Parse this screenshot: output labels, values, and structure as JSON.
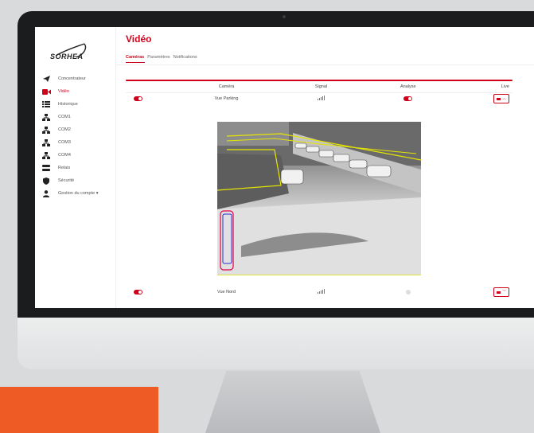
{
  "brand": {
    "logo_text": "SORHEA"
  },
  "page": {
    "title": "Vidéo"
  },
  "tabs": [
    {
      "label": "Caméras",
      "active": true
    },
    {
      "label": "Paramètres",
      "active": false
    },
    {
      "label": "Notifications",
      "active": false
    }
  ],
  "sidebar": {
    "items": [
      {
        "label": "Concentrateur",
        "icon": "send-icon"
      },
      {
        "label": "Vidéo",
        "icon": "video-camera-icon",
        "active": true
      },
      {
        "label": "Historique",
        "icon": "list-icon"
      },
      {
        "label": "COM1",
        "icon": "network-icon"
      },
      {
        "label": "COM2",
        "icon": "network-icon"
      },
      {
        "label": "COM3",
        "icon": "network-icon"
      },
      {
        "label": "COM4",
        "icon": "network-icon"
      },
      {
        "label": "Relais",
        "icon": "relay-icon"
      },
      {
        "label": "Sécurité",
        "icon": "shield-icon"
      },
      {
        "label": "Gestion du compte ▾",
        "icon": "user-icon"
      }
    ]
  },
  "table": {
    "headers": [
      "Caméra",
      "Signal",
      "Analyse",
      "Live"
    ],
    "rows": [
      {
        "enabled": true,
        "name": "Vue Parking",
        "analyse": true,
        "expanded": true
      },
      {
        "enabled": true,
        "name": "Vue Nord",
        "analyse": false,
        "expanded": false
      }
    ]
  },
  "colors": {
    "accent": "#d0021b",
    "signal": "#e8540d",
    "promo": "#ef5b25"
  }
}
